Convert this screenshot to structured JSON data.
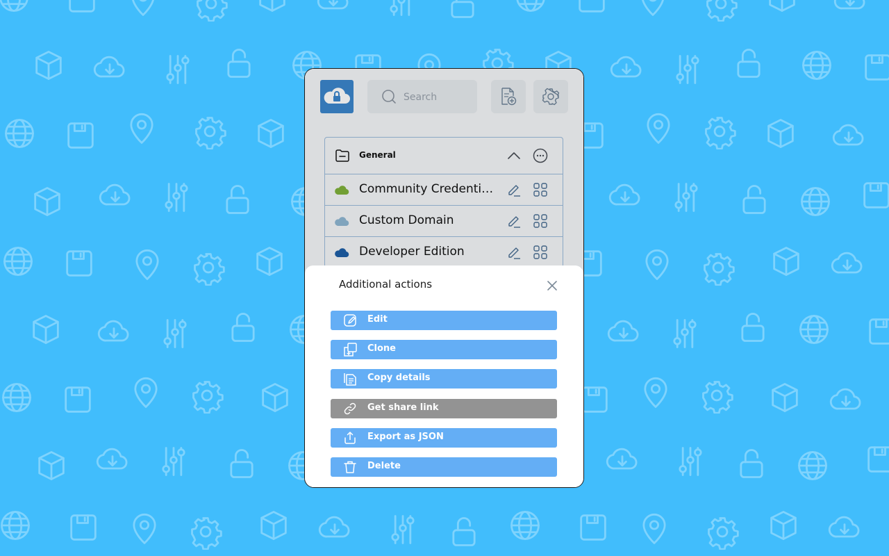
{
  "search": {
    "placeholder": "Search"
  },
  "group": {
    "title": "General"
  },
  "orgs": [
    {
      "name": "Community Credentials",
      "color": "#7fb23a"
    },
    {
      "name": "Custom Domain",
      "color": "#8fb7d3"
    },
    {
      "name": "Developer Edition",
      "color": "#1d5fa8"
    }
  ],
  "sheet": {
    "title": "Additional actions",
    "actions": [
      {
        "label": "Edit",
        "icon": "edit-icon"
      },
      {
        "label": "Clone",
        "icon": "clone-icon"
      },
      {
        "label": "Copy details",
        "icon": "copy-document-icon"
      },
      {
        "label": "Get share link",
        "icon": "link-icon",
        "state": "disabled"
      },
      {
        "label": "Export as JSON",
        "icon": "export-icon"
      },
      {
        "label": "Delete",
        "icon": "trash-icon"
      }
    ]
  },
  "colors": {
    "background": "#41bdfc",
    "pattern": "#7fd3fd",
    "action_button": "#64aef5",
    "action_button_disabled": "#939393",
    "logo": "#3b86cc"
  }
}
